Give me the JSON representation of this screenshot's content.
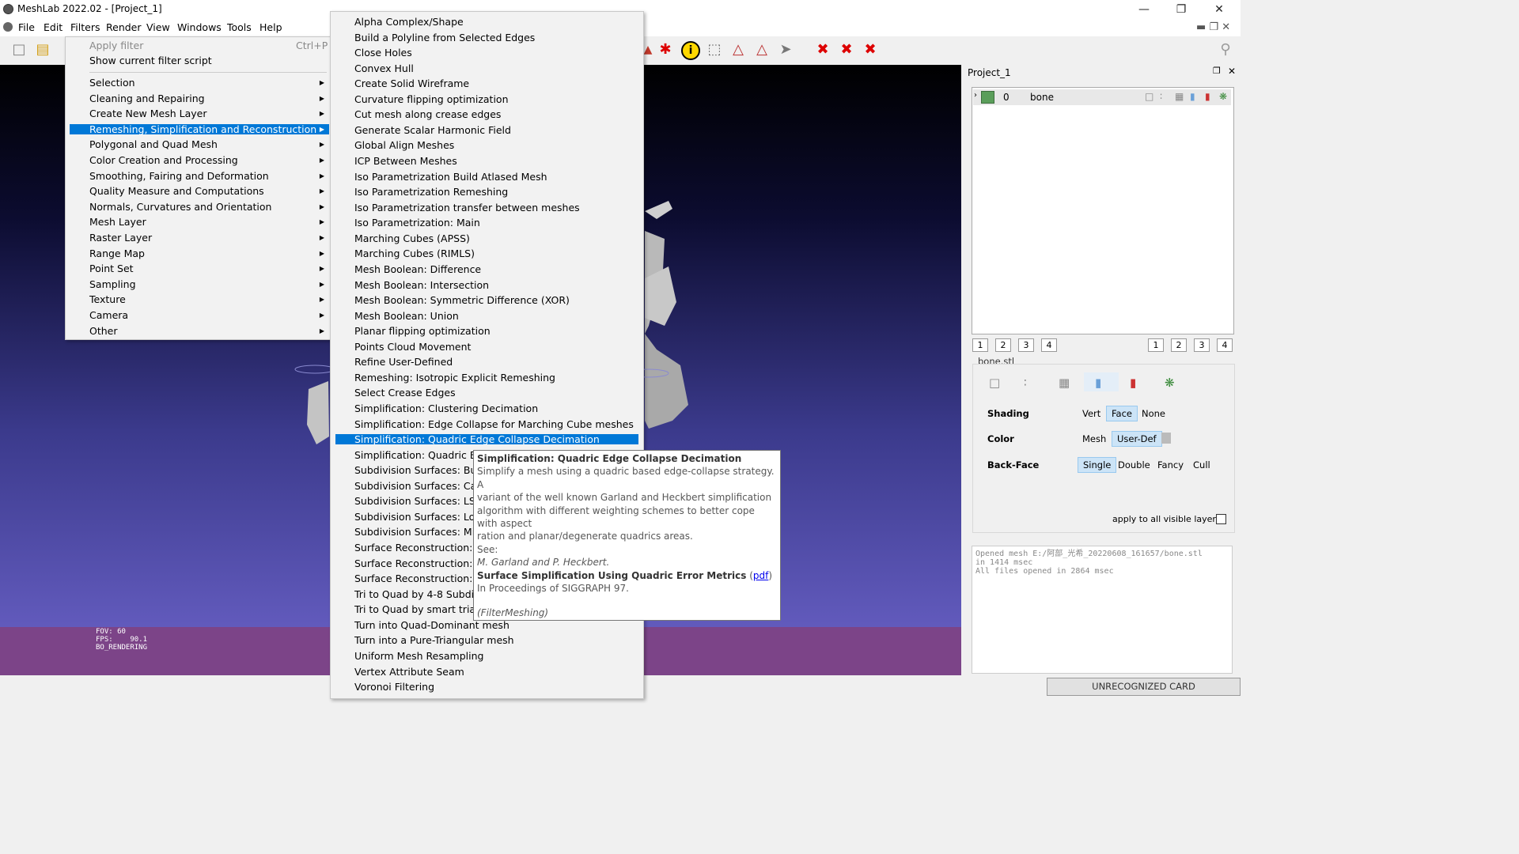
{
  "window": {
    "title": "MeshLab 2022.02 - [Project_1]",
    "controls": [
      "minimize-icon",
      "restore-icon",
      "close-icon"
    ]
  },
  "menubar": [
    "File",
    "Edit",
    "Filters",
    "Render",
    "View",
    "Windows",
    "Tools",
    "Help"
  ],
  "filters_menu": {
    "apply_filter": "Apply filter",
    "apply_shortcut": "Ctrl+P",
    "show_script": "Show current filter script",
    "items": [
      "Selection",
      "Cleaning and Repairing",
      "Create New Mesh Layer",
      "Remeshing, Simplification and Reconstruction",
      "Polygonal and Quad Mesh",
      "Color Creation and Processing",
      "Smoothing, Fairing and Deformation",
      "Quality Measure and Computations",
      "Normals, Curvatures and Orientation",
      "Mesh Layer",
      "Raster Layer",
      "Range Map",
      "Point Set",
      "Sampling",
      "Texture",
      "Camera",
      "Other"
    ],
    "highlighted": "Remeshing, Simplification and Reconstruction"
  },
  "submenu": {
    "items": [
      "Alpha Complex/Shape",
      "Build a Polyline from Selected Edges",
      "Close Holes",
      "Convex Hull",
      "Create Solid Wireframe",
      "Curvature flipping optimization",
      "Cut mesh along crease edges",
      "Generate Scalar Harmonic Field",
      "Global Align Meshes",
      "ICP Between Meshes",
      "Iso Parametrization Build Atlased Mesh",
      "Iso Parametrization Remeshing",
      "Iso Parametrization transfer between meshes",
      "Iso Parametrization: Main",
      "Marching Cubes (APSS)",
      "Marching Cubes (RIMLS)",
      "Mesh Boolean: Difference",
      "Mesh Boolean: Intersection",
      "Mesh Boolean: Symmetric Difference (XOR)",
      "Mesh Boolean: Union",
      "Planar flipping optimization",
      "Points Cloud Movement",
      "Refine User-Defined",
      "Remeshing: Isotropic Explicit Remeshing",
      "Select Crease Edges",
      "Simplification: Clustering Decimation",
      "Simplification: Edge Collapse for Marching Cube meshes",
      "Simplification: Quadric Edge Collapse Decimation",
      "Simplification: Quadric Edge",
      "Subdivision Surfaces: Butter",
      "Subdivision Surfaces: Catmu",
      "Subdivision Surfaces: LS3 Lo",
      "Subdivision Surfaces: Loop",
      "Subdivision Surfaces: Midpc",
      "Surface Reconstruction: Ball",
      "Surface Reconstruction: Scre",
      "Surface Reconstruction: VCG",
      "Tri to Quad by 4-8 Subdivisi",
      "Tri to Quad by smart triangl",
      "Turn into Quad-Dominant mesh",
      "Turn into a Pure-Triangular mesh",
      "Uniform Mesh Resampling",
      "Vertex Attribute Seam",
      "Voronoi Filtering"
    ],
    "highlighted": "Simplification: Quadric Edge Collapse Decimation"
  },
  "tooltip": {
    "title": "Simplification: Quadric Edge Collapse Decimation",
    "lines": [
      "Simplify a mesh using a quadric based edge-collapse strategy. A",
      "variant of the well known Garland and Heckbert simplification",
      "algorithm with different weighting schemes to better cope with aspect",
      "ration and planar/degenerate quadrics areas.",
      "See:"
    ],
    "authors": "M. Garland and P. Heckbert.",
    "paper_title": "Surface Simplification Using Quadric Error Metrics",
    "paper_link": "pdf",
    "proceedings": "In Proceedings of SIGGRAPH 97.",
    "plugin": "(FilterMeshing)"
  },
  "viewport": {
    "stats": [
      "FOV: 60",
      "FPS:    90.1",
      "BO_RENDERING"
    ]
  },
  "project_panel": {
    "title": "Project_1",
    "layer": {
      "index": "0",
      "name": "bone"
    },
    "left_nums": [
      "1",
      "2",
      "3",
      "4"
    ],
    "right_nums": [
      "1",
      "2",
      "3",
      "4"
    ],
    "file_label": "bone.stl",
    "shading": {
      "label": "Shading",
      "options": [
        "Vert",
        "Face",
        "None"
      ],
      "selected": "Face"
    },
    "color": {
      "label": "Color",
      "options": [
        "Mesh",
        "User-Def"
      ],
      "selected": "User-Def"
    },
    "backface": {
      "label": "Back-Face",
      "options": [
        "Single",
        "Double",
        "Fancy",
        "Cull"
      ],
      "selected": "Single"
    },
    "apply_all": "apply to all visible layers"
  },
  "log": [
    "Opened mesh E:/阿部_光希_20220608_161657/bone.stl",
    "in 1414 msec",
    "All files opened in 2864 msec"
  ],
  "status": {
    "card": "UNRECOGNIZED CARD"
  }
}
